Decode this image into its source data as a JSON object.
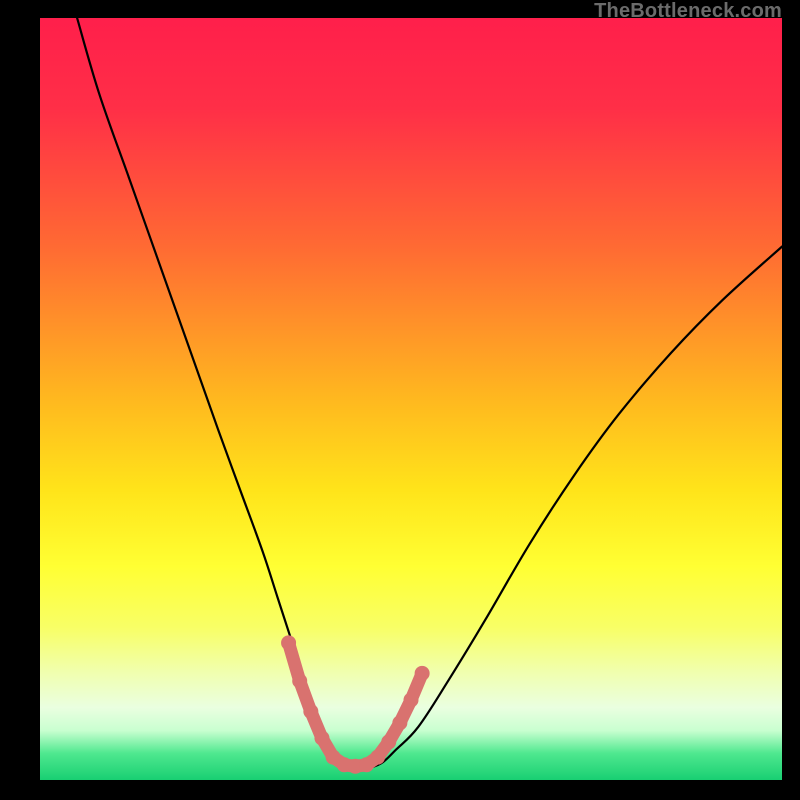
{
  "attribution": "TheBottleneck.com",
  "colors": {
    "background": "#000000",
    "gradient_stops": [
      {
        "offset": 0.0,
        "color": "#ff1f4b"
      },
      {
        "offset": 0.12,
        "color": "#ff2f47"
      },
      {
        "offset": 0.3,
        "color": "#ff6a33"
      },
      {
        "offset": 0.5,
        "color": "#ffb81f"
      },
      {
        "offset": 0.62,
        "color": "#ffe41a"
      },
      {
        "offset": 0.72,
        "color": "#ffff33"
      },
      {
        "offset": 0.8,
        "color": "#f8ff66"
      },
      {
        "offset": 0.86,
        "color": "#f0ffb0"
      },
      {
        "offset": 0.905,
        "color": "#eaffe0"
      },
      {
        "offset": 0.935,
        "color": "#c9ffd0"
      },
      {
        "offset": 0.965,
        "color": "#4fe88f"
      },
      {
        "offset": 1.0,
        "color": "#18cf72"
      }
    ],
    "curve": "#000000",
    "marker": "#d9726f"
  },
  "chart_data": {
    "type": "line",
    "title": "",
    "xlabel": "",
    "ylabel": "",
    "xlim": [
      0,
      100
    ],
    "ylim": [
      0,
      100
    ],
    "series": [
      {
        "name": "bottleneck-curve",
        "x": [
          5,
          8,
          12,
          16,
          20,
          24,
          27,
          30,
          32,
          34,
          36,
          37.5,
          39,
          40.5,
          42,
          44,
          46,
          48,
          51,
          55,
          60,
          66,
          72,
          78,
          85,
          92,
          100
        ],
        "y": [
          100,
          90,
          79,
          68,
          57,
          46,
          38,
          30,
          24,
          18,
          12,
          8,
          4.5,
          2.5,
          1.8,
          1.6,
          2.2,
          4,
          7,
          13,
          21,
          31,
          40,
          48,
          56,
          63,
          70
        ]
      }
    ],
    "markers": {
      "name": "highlight-band",
      "x": [
        33.5,
        35,
        36.5,
        38,
        39.5,
        41,
        42.5,
        44,
        45.5,
        47,
        48.5,
        50,
        51.5
      ],
      "y": [
        18,
        13,
        9,
        5.5,
        3,
        2,
        1.8,
        2,
        3,
        5,
        7.5,
        10.5,
        14
      ]
    }
  }
}
